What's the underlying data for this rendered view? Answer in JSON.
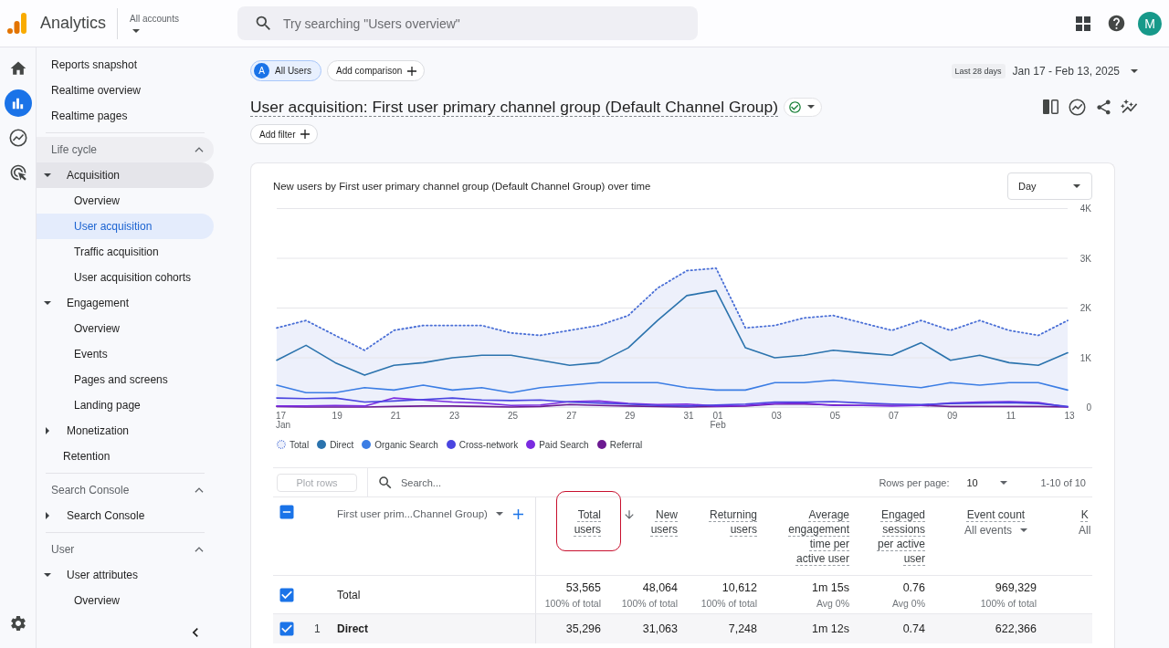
{
  "app_bar": {
    "product_name": "Analytics",
    "account_picker": {
      "label": "All accounts"
    },
    "search": {
      "placeholder": "Try searching \"Users overview\""
    },
    "avatar": {
      "letter": "M"
    }
  },
  "rail": [
    {
      "kind": "home",
      "selected": false
    },
    {
      "kind": "reports",
      "selected": true
    },
    {
      "kind": "explore",
      "selected": false
    },
    {
      "kind": "advertising",
      "selected": false
    }
  ],
  "nav": {
    "items": [
      {
        "label": "Reports snapshot",
        "selected": false
      },
      {
        "label": "Realtime overview",
        "selected": false
      },
      {
        "label": "Realtime pages",
        "selected": false
      }
    ],
    "sections": [
      {
        "title": "Life cycle",
        "expanded": true,
        "items": [
          {
            "label": "Acquisition",
            "kind": "folder",
            "expanded": true,
            "selected": false,
            "children": [
              {
                "label": "Overview",
                "selected": false
              },
              {
                "label": "User acquisition",
                "selected": true
              },
              {
                "label": "Traffic acquisition",
                "selected": false
              },
              {
                "label": "User acquisition cohorts",
                "selected": false
              }
            ]
          },
          {
            "label": "Engagement",
            "kind": "folder",
            "expanded": true,
            "selected": false,
            "children": [
              {
                "label": "Overview",
                "selected": false
              },
              {
                "label": "Events",
                "selected": false
              },
              {
                "label": "Pages and screens",
                "selected": false
              },
              {
                "label": "Landing page",
                "selected": false
              }
            ]
          },
          {
            "label": "Monetization",
            "kind": "folder",
            "expanded": false,
            "selected": false
          },
          {
            "label": "Retention",
            "kind": "page",
            "selected": false
          }
        ]
      },
      {
        "title": "Search Console",
        "expanded": true,
        "items": [
          {
            "label": "Search Console",
            "kind": "folder",
            "expanded": false,
            "selected": false
          }
        ]
      },
      {
        "title": "User",
        "expanded": true,
        "items": [
          {
            "label": "User attributes",
            "kind": "folder",
            "expanded": true,
            "selected": false,
            "children": [
              {
                "label": "Overview",
                "selected": false
              }
            ]
          }
        ]
      }
    ]
  },
  "report": {
    "comparisons": [
      {
        "badge": "A",
        "label": "All Users",
        "selected": true
      }
    ],
    "add_comparison": "Add comparison",
    "date_range": {
      "preset": "Last 28 days",
      "range": "Jan 17 - Feb 13, 2025"
    },
    "title": "User acquisition: First user primary channel group (Default Channel Group)",
    "add_filter": "Add filter"
  },
  "chart_card": {
    "interval": "Day",
    "chart_data": {
      "type": "line",
      "title": "New users by First user primary channel group (Default Channel Group) over time",
      "categories": [
        "17",
        null,
        "19",
        null,
        "21",
        null,
        "23",
        null,
        "25",
        null,
        "27",
        null,
        "29",
        null,
        "31",
        "01",
        null,
        "03",
        null,
        "05",
        null,
        "07",
        null,
        "09",
        null,
        "11",
        null,
        "13"
      ],
      "annotations": [
        "Jan",
        "Feb"
      ],
      "grid": true,
      "ylim": [
        0,
        4000
      ],
      "yticks": [
        {
          "value": 4000,
          "label": "4K"
        },
        {
          "value": 3000,
          "label": "3K"
        },
        {
          "value": 2000,
          "label": "2K"
        },
        {
          "value": 1000,
          "label": "1K"
        },
        {
          "value": 0,
          "label": "0"
        }
      ],
      "series": [
        {
          "name": "Total",
          "color": "#4a6fd6",
          "line_style": "dotted",
          "type": "area",
          "values": [
            1600,
            1750,
            1450,
            1150,
            1550,
            1650,
            1650,
            1650,
            1500,
            1450,
            1550,
            1650,
            1850,
            2400,
            2750,
            2800,
            1600,
            1650,
            1800,
            1850,
            1700,
            1550,
            1750,
            1550,
            1750,
            1550,
            1450,
            1750
          ]
        },
        {
          "name": "Direct",
          "color": "#2b73ad",
          "line_style": "solid",
          "type": "line",
          "values": [
            950,
            1250,
            900,
            650,
            850,
            900,
            1000,
            1050,
            1050,
            950,
            850,
            900,
            1200,
            1750,
            2250,
            2350,
            1200,
            1000,
            1050,
            1150,
            1100,
            1050,
            1300,
            950,
            1050,
            900,
            850,
            1100
          ]
        },
        {
          "name": "Organic Search",
          "color": "#3b7de4",
          "line_style": "solid",
          "type": "line",
          "values": [
            450,
            300,
            300,
            400,
            350,
            450,
            350,
            400,
            300,
            400,
            450,
            500,
            500,
            500,
            400,
            350,
            350,
            500,
            500,
            550,
            500,
            450,
            400,
            500,
            450,
            500,
            500,
            350
          ]
        },
        {
          "name": "Cross-network",
          "color": "#4a45e0",
          "line_style": "solid",
          "type": "line",
          "values": [
            190,
            180,
            190,
            110,
            130,
            160,
            190,
            150,
            140,
            150,
            110,
            90,
            70,
            40,
            30,
            50,
            70,
            110,
            110,
            120,
            90,
            70,
            60,
            80,
            90,
            100,
            80,
            20
          ]
        },
        {
          "name": "Paid Search",
          "color": "#7a2be0",
          "line_style": "solid",
          "type": "line",
          "values": [
            30,
            30,
            40,
            30,
            190,
            150,
            110,
            90,
            40,
            50,
            120,
            130,
            80,
            60,
            70,
            30,
            40,
            80,
            90,
            40,
            40,
            30,
            40,
            90,
            110,
            120,
            100,
            10
          ]
        },
        {
          "name": "Referral",
          "color": "#6c1a91",
          "line_style": "solid",
          "type": "line",
          "values": [
            20,
            10,
            10,
            10,
            20,
            30,
            30,
            20,
            10,
            20,
            60,
            40,
            30,
            20,
            10,
            20,
            30,
            70,
            70,
            50,
            40,
            40,
            40,
            20,
            20,
            20,
            20,
            10
          ]
        }
      ]
    }
  },
  "table": {
    "plot_rows": {
      "label": "Plot rows",
      "disabled": true
    },
    "search": {
      "placeholder": "Search..."
    },
    "rows_per_page": {
      "label": "Rows per page:",
      "value": "10"
    },
    "pagination": "1-10 of 10",
    "select_all": {
      "checked": true,
      "indeterminate": true
    },
    "dimension": {
      "label": "First user prim...Channel Group)"
    },
    "columns": [
      {
        "label": "Total users",
        "sorted": false,
        "highlighted": true
      },
      {
        "label": "New users",
        "sorted": true,
        "highlighted": false
      },
      {
        "label": "Returning users",
        "sorted": false,
        "highlighted": false
      },
      {
        "label": "Average engagement time per active user",
        "sorted": false,
        "highlighted": false
      },
      {
        "label": "Engaged sessions per active user",
        "sorted": false,
        "highlighted": false
      },
      {
        "label": "Event count",
        "sorted": false,
        "highlighted": false,
        "filter": {
          "label": "All events",
          "dropdown": true
        }
      },
      {
        "label": "K",
        "sorted": false,
        "highlighted": false,
        "filter": {
          "label": "All",
          "dropdown": false
        }
      }
    ],
    "rows": [
      {
        "kind": "total",
        "label": "Total",
        "checked": true,
        "cells": [
          {
            "value": "53,565",
            "note": "100% of total"
          },
          {
            "value": "48,064",
            "note": "100% of total"
          },
          {
            "value": "10,612",
            "note": "100% of total"
          },
          {
            "value": "1m 15s",
            "note": "Avg 0%"
          },
          {
            "value": "0.76",
            "note": "Avg 0%"
          },
          {
            "value": "969,329",
            "note": "100% of total"
          }
        ]
      },
      {
        "kind": "item",
        "index": "1",
        "label": "Direct",
        "checked": true,
        "cells": [
          {
            "value": "35,296"
          },
          {
            "value": "31,063"
          },
          {
            "value": "7,248"
          },
          {
            "value": "1m 12s"
          },
          {
            "value": "0.74"
          },
          {
            "value": "622,366"
          }
        ]
      }
    ]
  }
}
